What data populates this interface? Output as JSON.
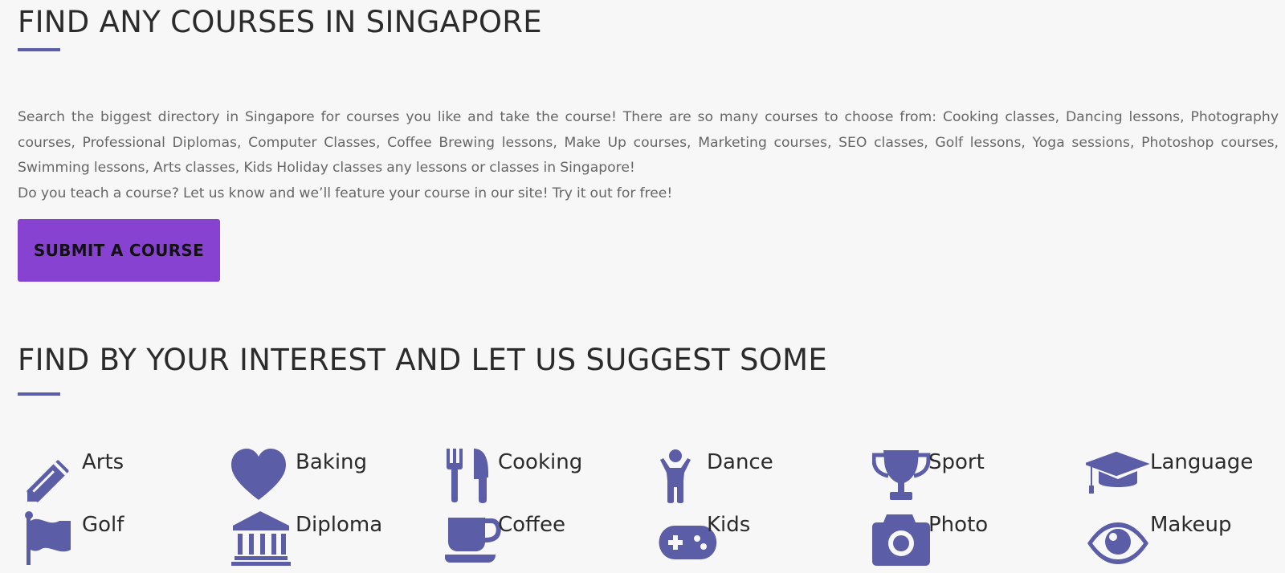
{
  "section1": {
    "title": "FIND ANY COURSES IN SINGAPORE",
    "paragraph1": "Search the biggest directory in Singapore for courses you like and take the course! There are so many courses to choose from: Cooking classes, Dancing lessons, Photography courses, Professional Diplomas, Computer Classes, Coffee Brewing lessons, Make Up courses, Marketing courses, SEO classes, Golf lessons, Yoga sessions, Photoshop courses, Swimming lessons, Arts classes, Kids Holiday classes any lessons or classes in Singapore!",
    "paragraph2": "Do you teach a course? Let us know and we’ll feature your course in our site! Try it out for free!",
    "button_label": "SUBMIT A COURSE"
  },
  "section2": {
    "title": "FIND BY YOUR INTEREST AND LET US SUGGEST SOME",
    "categories": [
      {
        "label": "Arts",
        "icon": "pencil-icon"
      },
      {
        "label": "Baking",
        "icon": "heart-icon"
      },
      {
        "label": "Cooking",
        "icon": "fork-knife-icon"
      },
      {
        "label": "Dance",
        "icon": "child-icon"
      },
      {
        "label": "Sport",
        "icon": "trophy-icon"
      },
      {
        "label": "Language",
        "icon": "graduation-cap-icon"
      },
      {
        "label": "Golf",
        "icon": "flag-icon"
      },
      {
        "label": "Diploma",
        "icon": "institution-icon"
      },
      {
        "label": "Coffee",
        "icon": "coffee-cup-icon"
      },
      {
        "label": "Kids",
        "icon": "gamepad-icon"
      },
      {
        "label": "Photo",
        "icon": "camera-icon"
      },
      {
        "label": "Makeup",
        "icon": "eye-icon"
      }
    ]
  },
  "colors": {
    "accent": "#5b5ea6",
    "button": "#8742d2",
    "background": "#f7f7f7"
  }
}
